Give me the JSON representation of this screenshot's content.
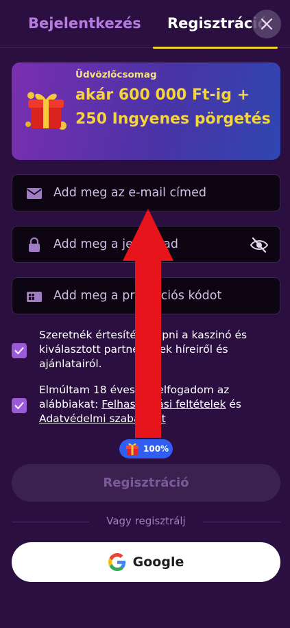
{
  "tabs": {
    "login": "Bejelentkezés",
    "register": "Regisztráció",
    "active": "register"
  },
  "colors": {
    "background": "#2a0f40",
    "accent": "#f2d230",
    "checkbox": "#9b5ad6",
    "badge": "#2f5ef0",
    "arrow": "#e8141c"
  },
  "promo": {
    "subtitle": "Üdvözlőcsomag",
    "title": "akár 600 000 Ft-ig + 250 Ingyenes pörgetés",
    "icon": "gift-box-icon"
  },
  "fields": {
    "email": {
      "placeholder": "Add meg az e-mail címed",
      "value": "",
      "icon": "envelope-icon"
    },
    "password": {
      "placeholder": "Add meg a jelszavad",
      "value": "",
      "icon": "lock-icon",
      "toggle_icon": "eye-off-icon"
    },
    "promo_code": {
      "placeholder": "Add meg a promóciós kódot",
      "value": "",
      "icon": "ticket-icon"
    }
  },
  "consents": {
    "newsletter": {
      "checked": true,
      "text": "Szeretnék értesítést kapni a kaszinó és kiválasztott partnereinek híreiről és ajánlatairól."
    },
    "terms": {
      "checked": true,
      "text_prefix": "Elmúltam 18 éves, és elfogadom az alábbiakat: ",
      "terms_link": "Felhasználási feltételek",
      "text_middle": " és ",
      "privacy_link": "Adatvédelmi szabályzat"
    }
  },
  "badge": {
    "label": "100%",
    "icon": "gift-icon"
  },
  "register_button": "Regisztráció",
  "divider": "Vagy regisztrálj",
  "google": {
    "label": "Google",
    "icon": "google-icon"
  }
}
